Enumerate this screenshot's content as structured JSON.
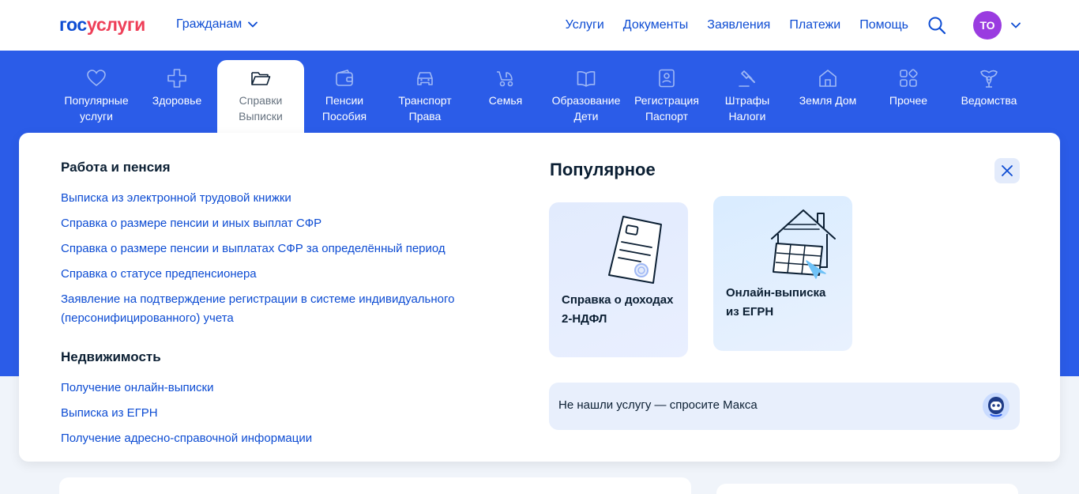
{
  "header": {
    "logo_part1": "гос",
    "logo_part2": "услуги",
    "audience": "Гражданам",
    "nav": [
      "Услуги",
      "Документы",
      "Заявления",
      "Платежи",
      "Помощь"
    ],
    "avatar_initials": "ТО"
  },
  "categories": [
    {
      "label": "Популярные\nуслуги",
      "icon": "heart-icon"
    },
    {
      "label": "Здоровье",
      "icon": "cross-icon"
    },
    {
      "label": "Справки\nВыписки",
      "icon": "folder-icon",
      "active": true
    },
    {
      "label": "Пенсии\nПособия",
      "icon": "wallet-icon"
    },
    {
      "label": "Транспорт\nПрава",
      "icon": "car-icon"
    },
    {
      "label": "Семья",
      "icon": "stroller-icon"
    },
    {
      "label": "Образование\nДети",
      "icon": "book-icon"
    },
    {
      "label": "Регистрация\nПаспорт",
      "icon": "passport-icon"
    },
    {
      "label": "Штрафы\nНалоги",
      "icon": "gavel-icon"
    },
    {
      "label": "Земля Дом",
      "icon": "house-icon"
    },
    {
      "label": "Прочее",
      "icon": "grid-icon"
    },
    {
      "label": "Ведомства",
      "icon": "emblem-icon"
    }
  ],
  "panel": {
    "section1": {
      "title": "Работа и пенсия",
      "links": [
        "Выписка из электронной трудовой книжки",
        "Справка о размере пенсии и иных выплат СФР",
        "Справка о размере пенсии и выплатах СФР за определённый период",
        "Справка о статусе предпенсионера",
        "Заявление на подтверждение регистрации в системе индивидуального",
        "(персонифицированного) учета"
      ]
    },
    "section2": {
      "title": "Недвижимость",
      "links": [
        "Получение онлайн-выписки",
        "Выписка из ЕГРН",
        "Получение адресно-справочной информации"
      ]
    },
    "popular_title": "Популярное",
    "cards": [
      {
        "label": "Справка о доходах\n2-НДФЛ",
        "icon": "document-icon"
      },
      {
        "label": "Онлайн-выписка\nиз ЕГРН",
        "icon": "house-document-icon"
      }
    ],
    "ask_text": "Не нашли услугу — спросите Макса"
  },
  "colors": {
    "brand_blue": "#0d4cd3",
    "brand_red": "#ee3f58",
    "band_blue": "#2b5ce8",
    "avatar": "#9a3ce0"
  }
}
